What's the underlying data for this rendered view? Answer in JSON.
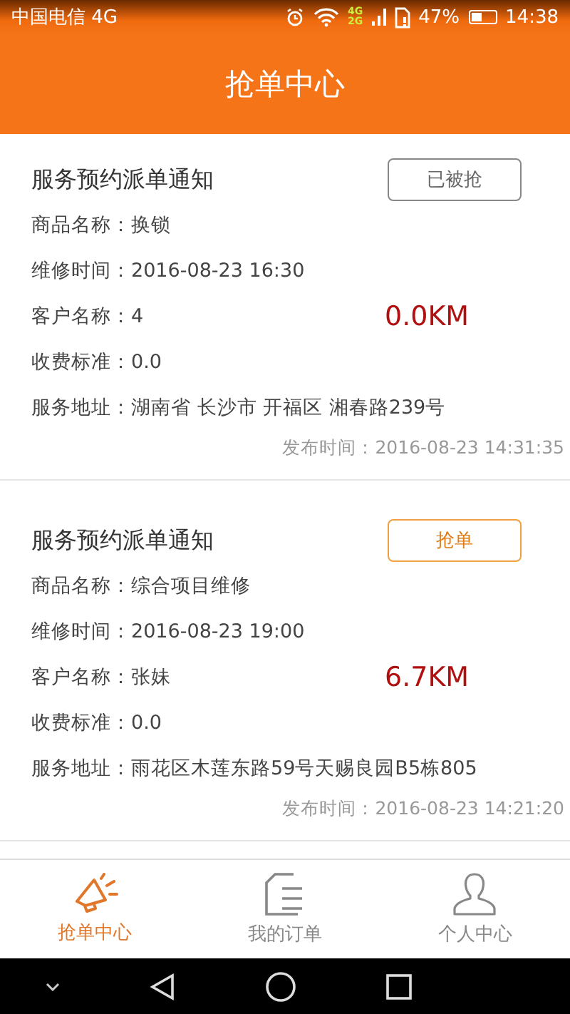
{
  "status_bar": {
    "carrier": "中国电信 4G",
    "network_top": "4G",
    "network_bottom": "2G",
    "battery_text": "47%",
    "time": "14:38"
  },
  "header": {
    "title": "抢单中心"
  },
  "orders": [
    {
      "title": "服务预约派单通知",
      "button": "已被抢",
      "grabbed": true,
      "fields": [
        {
          "label": "商品名称：",
          "value": "换锁"
        },
        {
          "label": "维修时间：",
          "value": "2016-08-23 16:30"
        },
        {
          "label": "客户名称：",
          "value": "4"
        },
        {
          "label": "收费标准：",
          "value": "0.0"
        },
        {
          "label": "服务地址：",
          "value": "湖南省 长沙市 开福区 湘春路239号"
        }
      ],
      "distance": "0.0KM",
      "published": "发布时间：2016-08-23 14:31:35"
    },
    {
      "title": "服务预约派单通知",
      "button": "抢单",
      "grabbed": false,
      "fields": [
        {
          "label": "商品名称：",
          "value": "综合项目维修"
        },
        {
          "label": "维修时间：",
          "value": "2016-08-23 19:00"
        },
        {
          "label": "客户名称：",
          "value": "张妹"
        },
        {
          "label": "收费标准：",
          "value": "0.0"
        },
        {
          "label": "服务地址：",
          "value": "雨花区木莲东路59号天赐良园B5栋805"
        }
      ],
      "distance": "6.7KM",
      "published": "发布时间：2016-08-23 14:21:20"
    }
  ],
  "tabs": [
    {
      "label": "抢单中心",
      "kind": "grab",
      "selected": true
    },
    {
      "label": "我的订单",
      "kind": "orders",
      "selected": false
    },
    {
      "label": "个人中心",
      "kind": "profile",
      "selected": false
    }
  ]
}
